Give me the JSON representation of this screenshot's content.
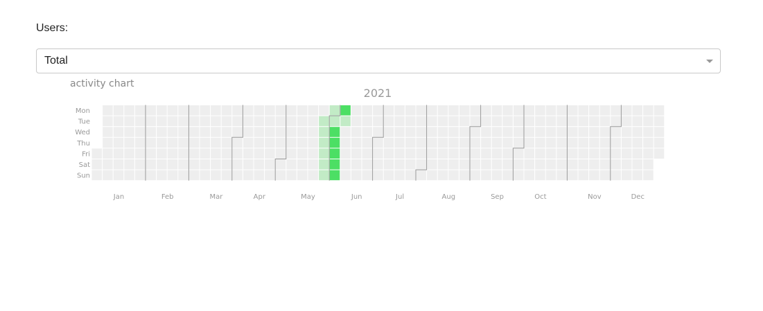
{
  "users_label": "Users:",
  "select": {
    "value": "Total"
  },
  "chart_caption": "activity chart",
  "colors": {
    "empty": "#eeeeee",
    "level1": "#c2ebc6",
    "level2": "#4cdf64",
    "divider": "#999999",
    "label": "#999999"
  },
  "chart_data": {
    "type": "heatmap",
    "title": "2021",
    "year": 2021,
    "week_start": "Monday",
    "day_labels": [
      "Mon",
      "Tue",
      "Wed",
      "Thu",
      "Fri",
      "Sat",
      "Sun"
    ],
    "month_labels": [
      "Jan",
      "Feb",
      "Mar",
      "Apr",
      "May",
      "Jun",
      "Jul",
      "Aug",
      "Sep",
      "Oct",
      "Nov",
      "Dec"
    ],
    "value_range": [
      0,
      2
    ],
    "active_days": [
      {
        "date": "2021-05-25",
        "value": 1
      },
      {
        "date": "2021-05-26",
        "value": 1
      },
      {
        "date": "2021-05-27",
        "value": 1
      },
      {
        "date": "2021-05-28",
        "value": 1
      },
      {
        "date": "2021-05-29",
        "value": 1
      },
      {
        "date": "2021-05-30",
        "value": 1
      },
      {
        "date": "2021-05-31",
        "value": 1
      },
      {
        "date": "2021-06-01",
        "value": 1
      },
      {
        "date": "2021-06-02",
        "value": 2
      },
      {
        "date": "2021-06-03",
        "value": 2
      },
      {
        "date": "2021-06-04",
        "value": 2
      },
      {
        "date": "2021-06-05",
        "value": 2
      },
      {
        "date": "2021-06-06",
        "value": 2
      },
      {
        "date": "2021-06-07",
        "value": 2
      },
      {
        "date": "2021-06-08",
        "value": 1
      }
    ]
  }
}
